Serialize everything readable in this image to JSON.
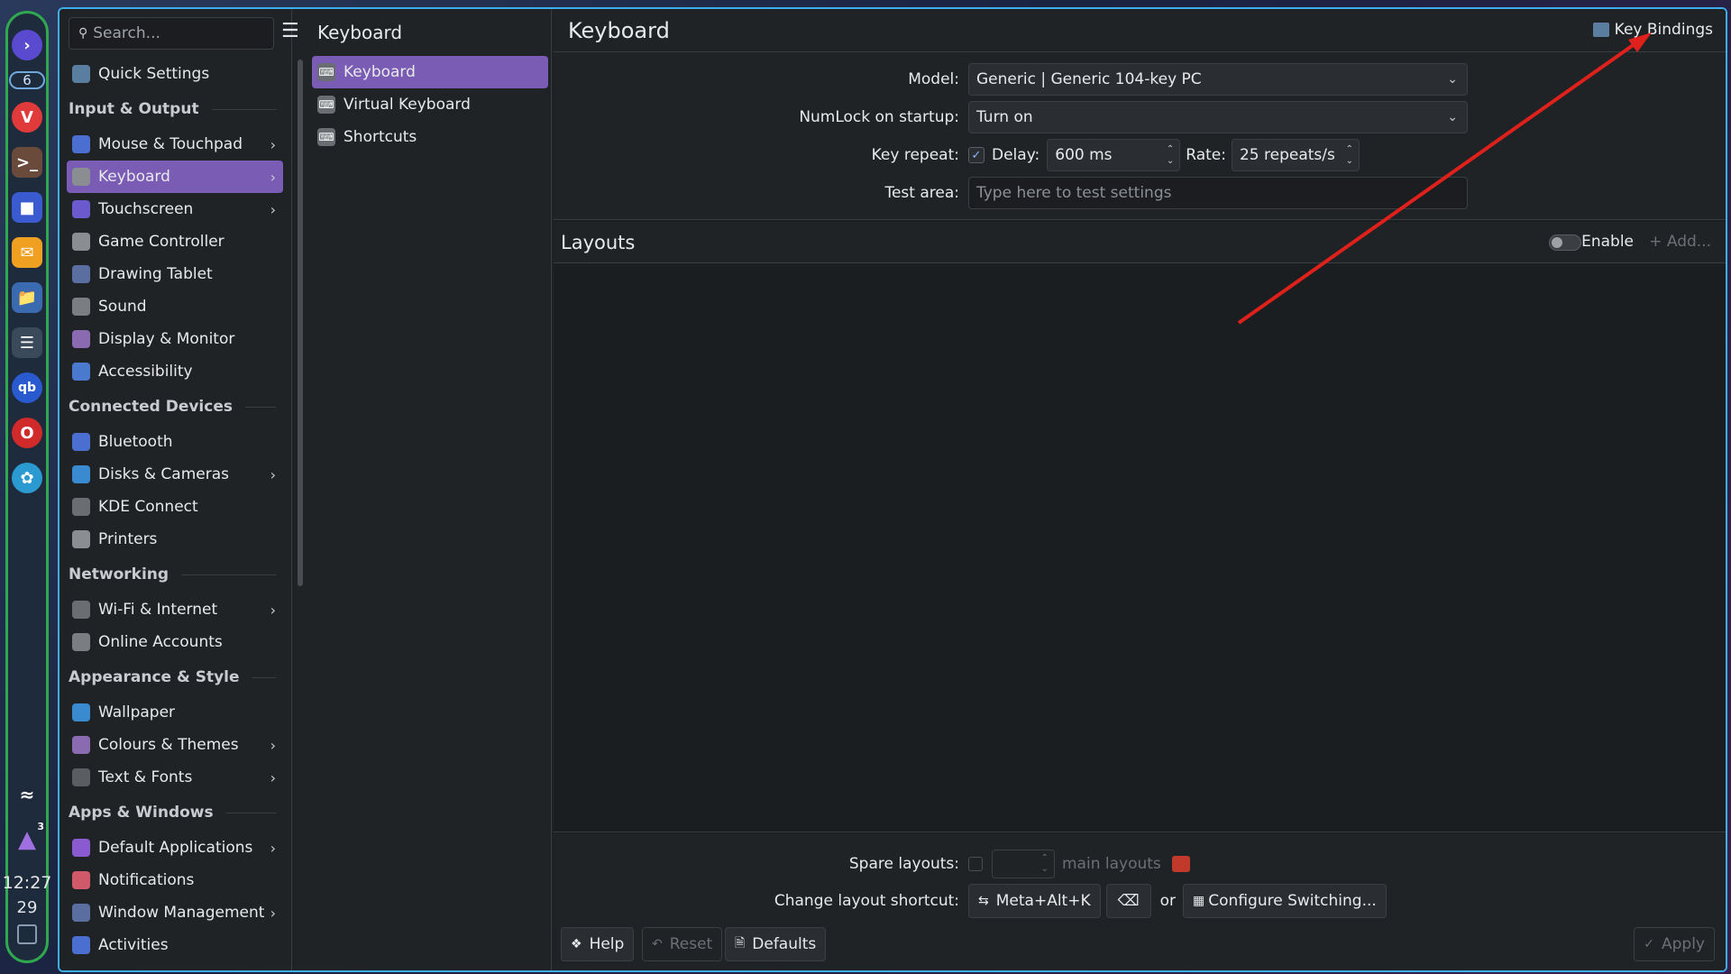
{
  "dock": {
    "badge": "6",
    "notif_count": "3",
    "time": "12:27",
    "date": "29",
    "icons": [
      "kde-connect-icon",
      "vivaldi-icon",
      "terminal-icon",
      "konsole-icon",
      "mail-icon",
      "dolphin-icon",
      "settings-icon",
      "qbittorrent-icon",
      "opera-icon",
      "kdeconnect-app-icon"
    ]
  },
  "sidebar": {
    "search_placeholder": "Search...",
    "items": [
      {
        "type": "item",
        "label": "Quick Settings",
        "icon": "quick-settings-icon",
        "color": "#5a7ea0"
      },
      {
        "type": "head",
        "label": "Input & Output"
      },
      {
        "type": "item",
        "label": "Mouse & Touchpad",
        "icon": "mouse-icon",
        "color": "#4a6fd0",
        "chevron": true
      },
      {
        "type": "item",
        "label": "Keyboard",
        "icon": "keyboard-icon",
        "color": "#8a8e93",
        "chevron": true,
        "active": true
      },
      {
        "type": "item",
        "label": "Touchscreen",
        "icon": "touchscreen-icon",
        "color": "#6a5acd",
        "chevron": true
      },
      {
        "type": "item",
        "label": "Game Controller",
        "icon": "gamepad-icon",
        "color": "#8a8e93"
      },
      {
        "type": "item",
        "label": "Drawing Tablet",
        "icon": "tablet-icon",
        "color": "#5a6ea0"
      },
      {
        "type": "item",
        "label": "Sound",
        "icon": "sound-icon",
        "color": "#7a7e83"
      },
      {
        "type": "item",
        "label": "Display & Monitor",
        "icon": "display-icon",
        "color": "#8a6ab0"
      },
      {
        "type": "item",
        "label": "Accessibility",
        "icon": "accessibility-icon",
        "color": "#4a7ad0"
      },
      {
        "type": "head",
        "label": "Connected Devices"
      },
      {
        "type": "item",
        "label": "Bluetooth",
        "icon": "bluetooth-icon",
        "color": "#4a6fd0"
      },
      {
        "type": "item",
        "label": "Disks & Cameras",
        "icon": "disk-icon",
        "color": "#3a8ad0",
        "chevron": true
      },
      {
        "type": "item",
        "label": "KDE Connect",
        "icon": "kdeconnect-icon",
        "color": "#6a6e73"
      },
      {
        "type": "item",
        "label": "Printers",
        "icon": "printer-icon",
        "color": "#8a8e93"
      },
      {
        "type": "head",
        "label": "Networking"
      },
      {
        "type": "item",
        "label": "Wi-Fi & Internet",
        "icon": "wifi-icon",
        "color": "#6a6e73",
        "chevron": true
      },
      {
        "type": "item",
        "label": "Online Accounts",
        "icon": "accounts-icon",
        "color": "#7a7e83"
      },
      {
        "type": "head",
        "label": "Appearance & Style"
      },
      {
        "type": "item",
        "label": "Wallpaper",
        "icon": "wallpaper-icon",
        "color": "#3a8ad0"
      },
      {
        "type": "item",
        "label": "Colours & Themes",
        "icon": "themes-icon",
        "color": "#8a6ab0",
        "chevron": true
      },
      {
        "type": "item",
        "label": "Text & Fonts",
        "icon": "fonts-icon",
        "color": "#5a5e63",
        "chevron": true
      },
      {
        "type": "head",
        "label": "Apps & Windows"
      },
      {
        "type": "item",
        "label": "Default Applications",
        "icon": "star-icon",
        "color": "#8a5ad0",
        "chevron": true
      },
      {
        "type": "item",
        "label": "Notifications",
        "icon": "bell-icon",
        "color": "#d05a6a"
      },
      {
        "type": "item",
        "label": "Window Management",
        "icon": "window-icon",
        "color": "#5a6ea0",
        "chevron": true
      },
      {
        "type": "item",
        "label": "Activities",
        "icon": "activities-icon",
        "color": "#4a6fd0"
      }
    ]
  },
  "subnav": {
    "title": "Keyboard",
    "items": [
      {
        "label": "Keyboard",
        "active": true
      },
      {
        "label": "Virtual Keyboard"
      },
      {
        "label": "Shortcuts"
      }
    ]
  },
  "content": {
    "title": "Keyboard",
    "key_bindings": "Key Bindings",
    "model_label": "Model:",
    "model_value": "Generic | Generic 104-key PC",
    "numlock_label": "NumLock on startup:",
    "numlock_value": "Turn on",
    "repeat_label": "Key repeat:",
    "delay_label": "Delay:",
    "delay_value": "600 ms",
    "rate_label": "Rate:",
    "rate_value": "25 repeats/s",
    "test_label": "Test area:",
    "test_placeholder": "Type here to test settings",
    "layouts_title": "Layouts",
    "enable_label": "Enable",
    "add_label": "+ Add...",
    "spare_label": "Spare layouts:",
    "main_layouts": "main layouts",
    "shortcut_label": "Change layout shortcut:",
    "shortcut_value": "Meta+Alt+K",
    "or_label": "or",
    "configure_switching": "Configure Switching..."
  },
  "footer": {
    "help": "Help",
    "reset": "Reset",
    "defaults": "Defaults",
    "apply": "Apply"
  },
  "annotation": {
    "color": "#e0201a"
  }
}
